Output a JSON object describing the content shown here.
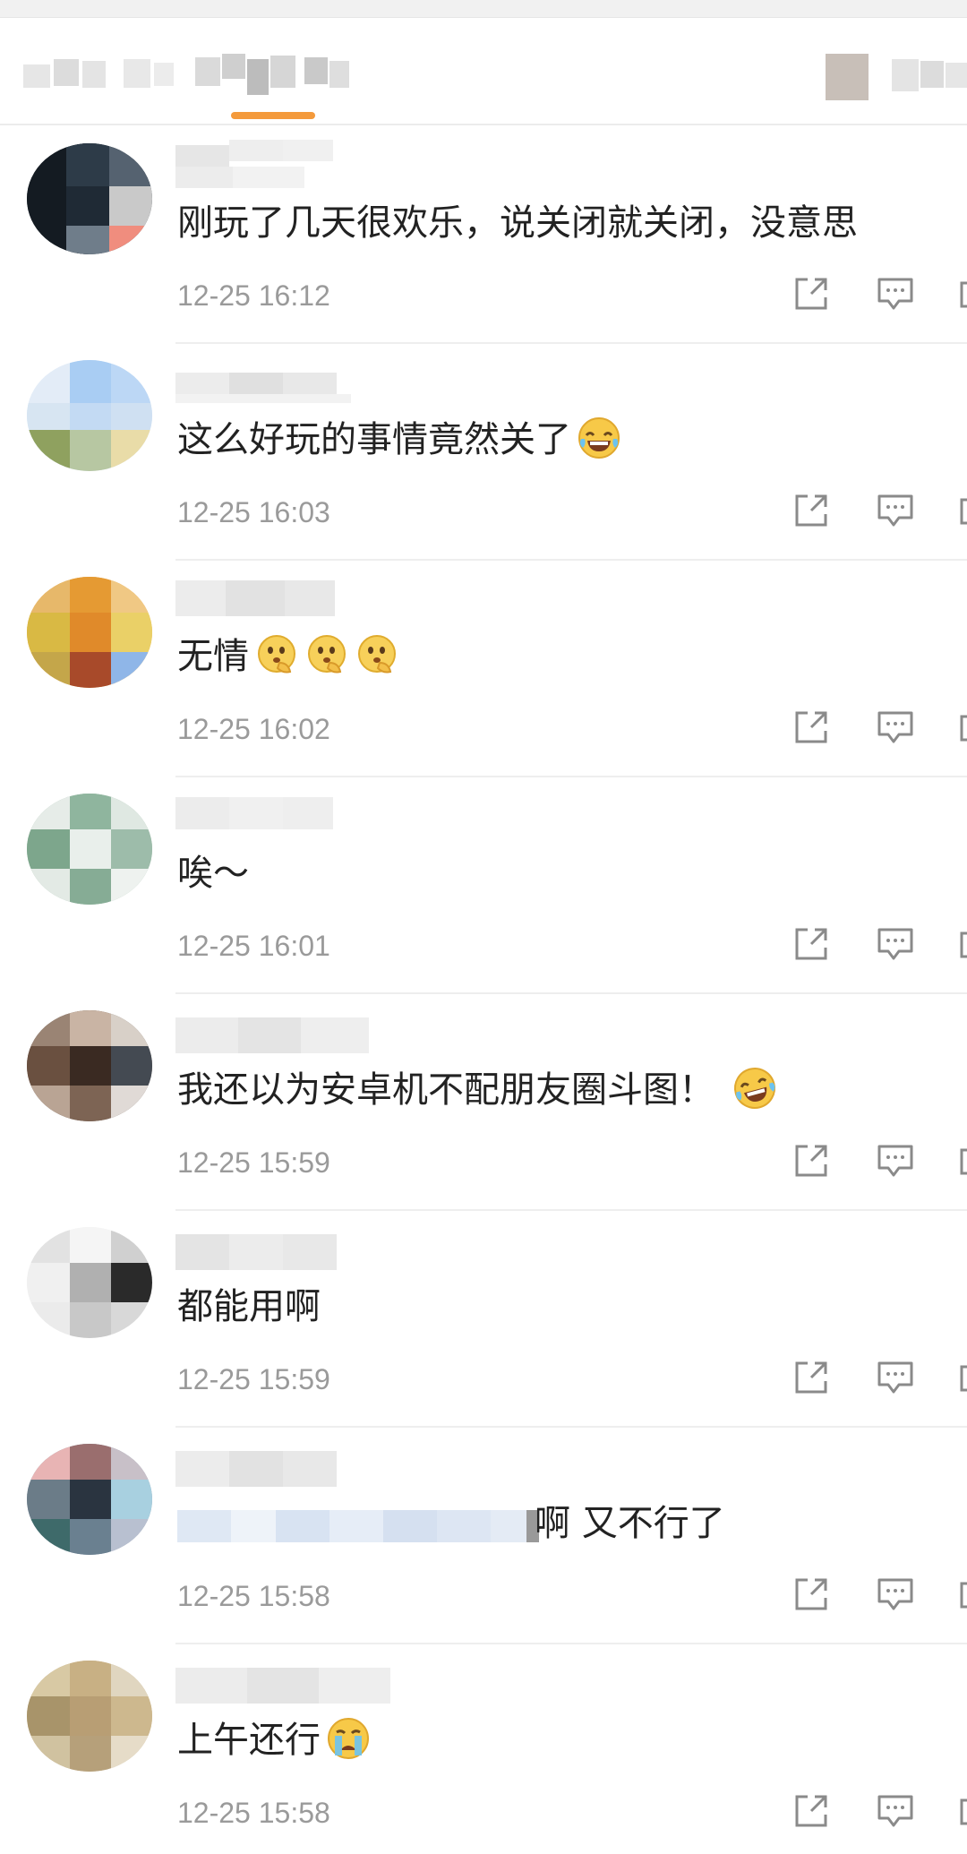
{
  "tabs": [
    {
      "label": ""
    },
    {
      "label": ""
    },
    {
      "label": ""
    }
  ],
  "comments": [
    {
      "text": "刚玩了几天很欢乐，说关闭就关闭，没意思",
      "time": "12-25 16:12",
      "emoji": []
    },
    {
      "text": "这么好玩的事情竟然关了",
      "time": "12-25 16:03",
      "emoji": [
        "laugh-cry"
      ]
    },
    {
      "text": "无情",
      "time": "12-25 16:02",
      "emoji": [
        "think",
        "think",
        "think"
      ]
    },
    {
      "text": "唉～",
      "time": "12-25 16:01",
      "emoji": []
    },
    {
      "text": "我还以为安卓机不配朋友圈斗图！",
      "time": "12-25 15:59",
      "emoji": [
        "laugh-cry"
      ]
    },
    {
      "text": "都能用啊",
      "time": "12-25 15:59",
      "emoji": []
    },
    {
      "text": "啊 又不行了",
      "time": "12-25 15:58",
      "emoji": []
    },
    {
      "text": "上午还行",
      "time": "12-25 15:58",
      "emoji": [
        "crying"
      ]
    }
  ],
  "colors": {
    "accent": "#f49a3b",
    "timestamp": "#9a9a9a",
    "icon": "#8a8a8a",
    "divider": "#eeeeee"
  },
  "icons": {
    "share": "share-icon",
    "reply": "reply-icon",
    "more": "more-icon"
  }
}
